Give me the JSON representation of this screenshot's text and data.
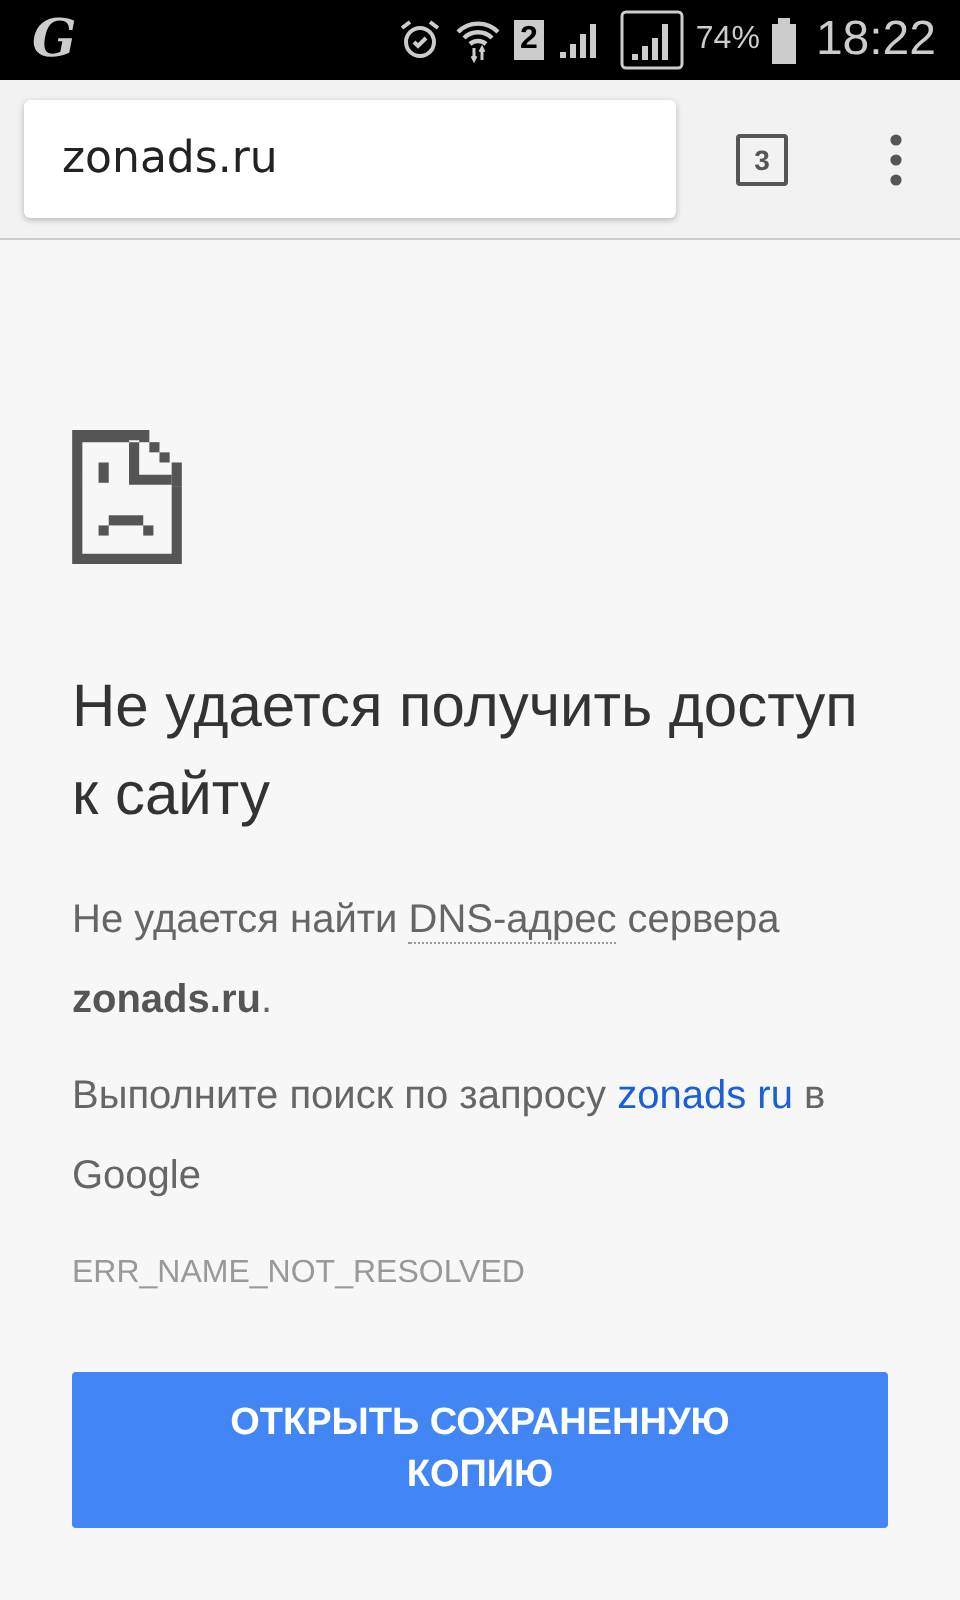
{
  "status_bar": {
    "app_logo": "G",
    "sim_slot": "2",
    "battery": "74%",
    "time": "18:22"
  },
  "toolbar": {
    "url": "zonads.ru",
    "tab_count": "3"
  },
  "error_page": {
    "heading": "Не удается получить доступ к сайту",
    "message": {
      "before": "Не удается найти ",
      "term": "DNS-адрес",
      "after": " сервера **zonads.ru**."
    },
    "suggestion": {
      "before": "Выполните поиск по запросу ",
      "link": "zonads ru",
      "after": " в Google"
    },
    "error_code": "ERR_NAME_NOT_RESOLVED",
    "button": "ОТКРЫТЬ СОХРАНЕННУЮ КОПИЮ"
  }
}
